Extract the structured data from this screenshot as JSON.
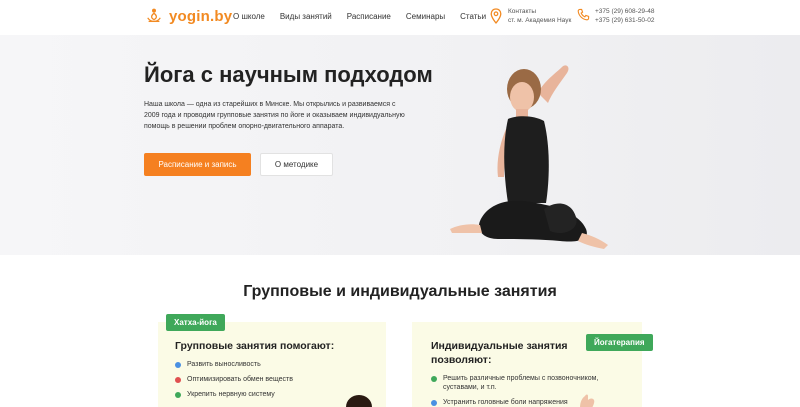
{
  "header": {
    "logo_text": "yogin.by",
    "nav": [
      "О школе",
      "Виды занятий",
      "Расписание",
      "Семинары",
      "Статьи"
    ],
    "contacts": {
      "title": "Контакты",
      "address": "ст. м. Академия Наук"
    },
    "phones": [
      "+375 (29) 608-29-48",
      "+375 (29) 631-50-02"
    ]
  },
  "hero": {
    "title": "Йога с научным подходом",
    "description": "Наша школа — одна из старейших в Минске. Мы открылись и развиваемся с 2009 года и проводим групповые занятия по йоге и оказываем индивидуальную помощь в решении проблем опорно-двигательного аппарата.",
    "primary_button": "Расписание и запись",
    "secondary_button": "О методике"
  },
  "section": {
    "title": "Групповые и индивидуальные занятия",
    "group_card": {
      "tag": "Хатха-йога",
      "heading": "Групповые занятия помогают:",
      "items": [
        {
          "text": "Развить выносливость",
          "color": "#4a90e2"
        },
        {
          "text": "Оптимизировать обмен веществ",
          "color": "#e05050"
        },
        {
          "text": "Укрепить нервную систему",
          "color": "#3fa85a"
        }
      ]
    },
    "individual_card": {
      "tag": "Йогатерапия",
      "heading": "Индивидуальные занятия позволяют:",
      "items": [
        {
          "text": "Решить различные проблемы с позвоночником, суставами, и т.п.",
          "color": "#3fa85a"
        },
        {
          "text": "Устранить головные боли напряжения",
          "color": "#4a90e2"
        }
      ]
    }
  },
  "colors": {
    "accent": "#f58020",
    "tag_green": "#3fa85a",
    "card_bg": "#fbfbe6"
  }
}
